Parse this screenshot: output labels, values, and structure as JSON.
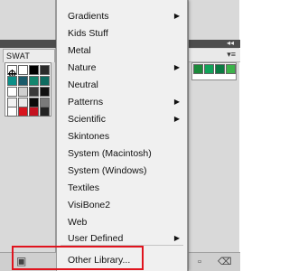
{
  "swatches_panel": {
    "tab_label": "SWAT"
  },
  "menu": {
    "items": [
      {
        "label": "Gradients",
        "submenu": true
      },
      {
        "label": "Kids Stuff",
        "submenu": false
      },
      {
        "label": "Metal",
        "submenu": false
      },
      {
        "label": "Nature",
        "submenu": true
      },
      {
        "label": "Neutral",
        "submenu": false
      },
      {
        "label": "Patterns",
        "submenu": true
      },
      {
        "label": "Scientific",
        "submenu": true
      },
      {
        "label": "Skintones",
        "submenu": false
      },
      {
        "label": "System (Macintosh)",
        "submenu": false
      },
      {
        "label": "System (Windows)",
        "submenu": false
      },
      {
        "label": "Textiles",
        "submenu": false
      },
      {
        "label": "VisiBone2",
        "submenu": false
      },
      {
        "label": "Web",
        "submenu": false
      },
      {
        "label": "User Defined",
        "submenu": true
      }
    ],
    "other_library": "Other Library...",
    "submenu_arrow": "▶"
  },
  "icons": {
    "collapse": "◂◂",
    "panel_menu": "▾≡"
  },
  "colors": {
    "highlight_border": "#e0141e",
    "menu_background": "#f0f0f0"
  }
}
